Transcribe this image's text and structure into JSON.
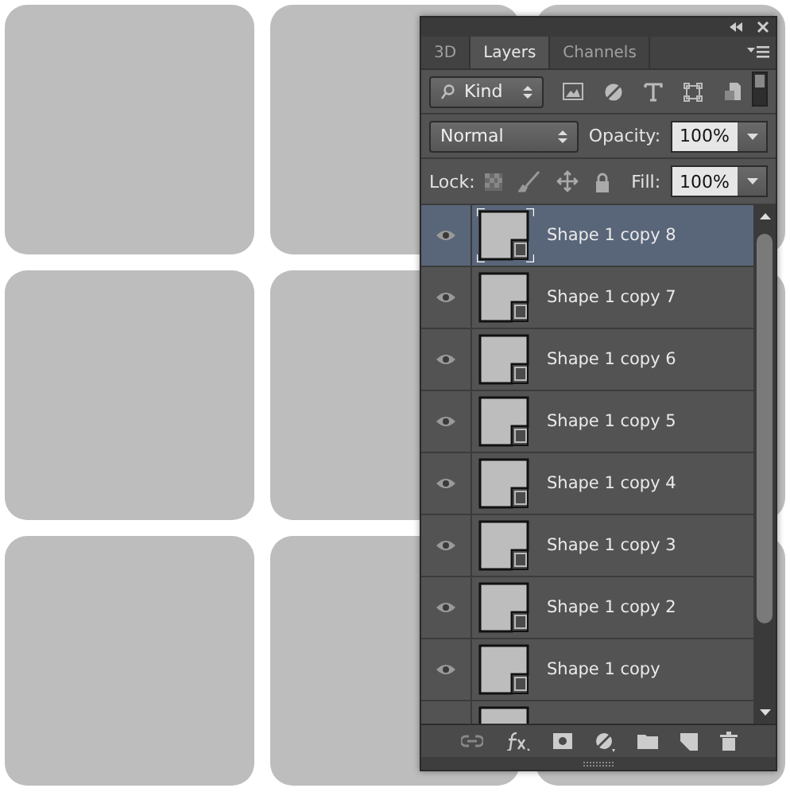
{
  "tabs": [
    {
      "label": "3D",
      "selected": false
    },
    {
      "label": "Layers",
      "selected": true
    },
    {
      "label": "Channels",
      "selected": false
    }
  ],
  "filter": {
    "label": "Kind"
  },
  "blend_mode": {
    "value": "Normal"
  },
  "opacity": {
    "label": "Opacity:",
    "value": "100%"
  },
  "lock": {
    "label": "Lock:"
  },
  "fill": {
    "label": "Fill:",
    "value": "100%"
  },
  "layers": [
    {
      "kind": "full",
      "name": "Shape 1 copy 8",
      "visible": true,
      "selected": true
    },
    {
      "kind": "full",
      "name": "Shape 1 copy 7",
      "visible": true,
      "selected": false
    },
    {
      "kind": "full",
      "name": "Shape 1 copy 6",
      "visible": true,
      "selected": false
    },
    {
      "kind": "full",
      "name": "Shape 1 copy 5",
      "visible": true,
      "selected": false
    },
    {
      "kind": "full",
      "name": "Shape 1 copy 4",
      "visible": true,
      "selected": false
    },
    {
      "kind": "full",
      "name": "Shape 1 copy 3",
      "visible": true,
      "selected": false
    },
    {
      "kind": "full",
      "name": "Shape 1 copy 2",
      "visible": true,
      "selected": false
    },
    {
      "kind": "full",
      "name": "Shape 1 copy",
      "visible": true,
      "selected": false
    },
    {
      "kind": "cut",
      "selected": false
    }
  ]
}
